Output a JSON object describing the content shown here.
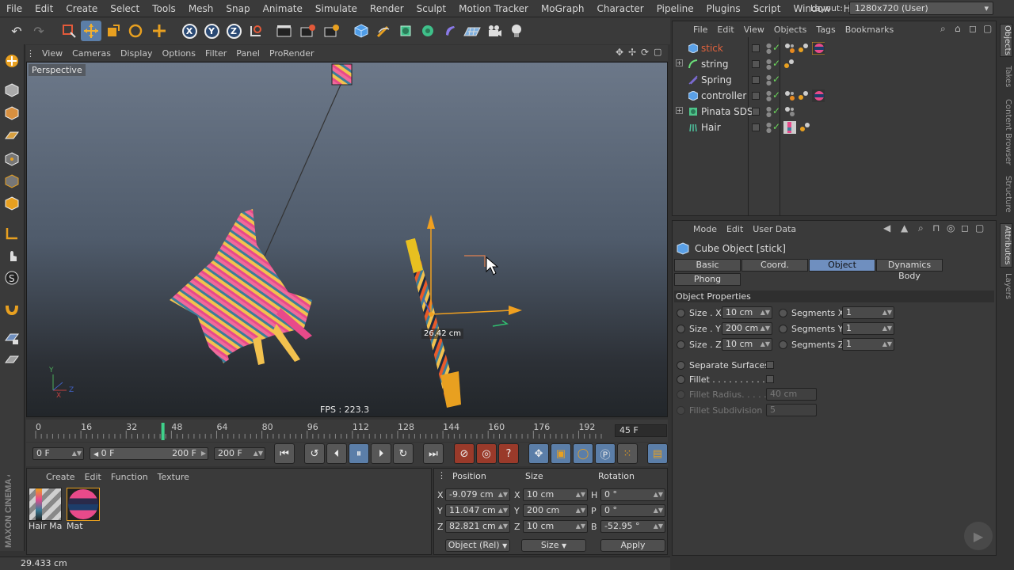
{
  "menubar": {
    "items": [
      "File",
      "Edit",
      "Create",
      "Select",
      "Tools",
      "Mesh",
      "Snap",
      "Animate",
      "Simulate",
      "Render",
      "Sculpt",
      "Motion Tracker",
      "MoGraph",
      "Character",
      "Pipeline",
      "Plugins",
      "Script",
      "Window",
      "Help"
    ],
    "layout_label": "Layout:",
    "layout_value": "1280x720 (User)"
  },
  "toolbar": {
    "icons": [
      "undo-icon",
      "redo-icon",
      "live-selection-icon",
      "move-icon",
      "scale-icon",
      "rotate-icon",
      "add-icon",
      "x-axis-icon",
      "y-axis-icon",
      "z-axis-icon",
      "coordinate-system-icon",
      "render-view-icon",
      "render-picture-queue-icon",
      "edit-render-settings-icon",
      "cube-icon",
      "pen-icon",
      "subdivision-icon",
      "array-icon",
      "deformer-icon",
      "floor-icon",
      "camera-icon",
      "light-icon"
    ],
    "axis_x": "X",
    "axis_y": "Y",
    "axis_z": "Z"
  },
  "viewport": {
    "menu": [
      "View",
      "Cameras",
      "Display",
      "Options",
      "Filter",
      "Panel",
      "ProRender"
    ],
    "camera_label": "Perspective",
    "fps": "FPS : 223.3",
    "dimension_label": "26.42 cm",
    "axis_y": "Y",
    "axis_x": "X",
    "axis_z": "Z"
  },
  "timeline": {
    "ticks": [
      "0",
      "16",
      "32",
      "48",
      "64",
      "80",
      "96",
      "112",
      "128",
      "144",
      "160",
      "176",
      "192"
    ],
    "current_frame_field": "45 F",
    "playhead_frame": 45,
    "max_frame": 200
  },
  "transport": {
    "start_field": "0 F",
    "range_start": "0 F",
    "range_end": "200 F",
    "end_field": "200 F"
  },
  "materials": {
    "menu": [
      "Create",
      "Edit",
      "Function",
      "Texture"
    ],
    "items": [
      {
        "label": "Hair Ma"
      },
      {
        "label": "Mat"
      }
    ]
  },
  "coordinates": {
    "headers": {
      "position": "Position",
      "size": "Size",
      "rotation": "Rotation"
    },
    "rows": [
      {
        "axis": "X",
        "pos": "-9.079 cm",
        "size_axis": "X",
        "size": "10 cm",
        "rot_axis": "H",
        "rot": "0 °"
      },
      {
        "axis": "Y",
        "pos": "11.047 cm",
        "size_axis": "Y",
        "size": "200 cm",
        "rot_axis": "P",
        "rot": "0 °"
      },
      {
        "axis": "Z",
        "pos": "82.821 cm",
        "size_axis": "Z",
        "size": "10 cm",
        "rot_axis": "B",
        "rot": "-52.95 °"
      }
    ],
    "mode_select": "Object (Rel)",
    "size_select": "Size",
    "apply_label": "Apply"
  },
  "statusbar": {
    "text": "29.433 cm"
  },
  "object_manager": {
    "menu": [
      "File",
      "Edit",
      "View",
      "Objects",
      "Tags",
      "Bookmarks"
    ],
    "objects": [
      {
        "name": "stick",
        "selected": true,
        "icon": "cube-object-icon",
        "color": "#5aa0e6"
      },
      {
        "name": "string",
        "selected": false,
        "icon": "spline-icon",
        "color": "#6be07a"
      },
      {
        "name": "Spring",
        "selected": false,
        "icon": "spring-icon",
        "color": "#7a6ad0"
      },
      {
        "name": "controller",
        "selected": false,
        "icon": "cube-object-icon",
        "color": "#5aa0e6"
      },
      {
        "name": "Pinata SDS",
        "selected": false,
        "icon": "subdivision-surface-icon",
        "color": "#4ec48a"
      },
      {
        "name": "Hair",
        "selected": false,
        "icon": "hair-icon",
        "color": "#4ec4a0"
      }
    ]
  },
  "attributes": {
    "menu": [
      "Mode",
      "Edit",
      "User Data"
    ],
    "title": "Cube Object [stick]",
    "tabs": [
      "Basic",
      "Coord.",
      "Object",
      "Dynamics Body",
      "Phong"
    ],
    "active_tab": "Object",
    "section": "Object Properties",
    "size_x_label": "Size . X",
    "size_x": "10 cm",
    "size_y_label": "Size . Y",
    "size_y": "200 cm",
    "size_z_label": "Size . Z",
    "size_z": "10 cm",
    "seg_x_label": "Segments X",
    "seg_x": "1",
    "seg_y_label": "Segments Y",
    "seg_y": "1",
    "seg_z_label": "Segments Z",
    "seg_z": "1",
    "separate_surfaces": "Separate Surfaces",
    "fillet": "Fillet . . . . . . . . . . .",
    "fillet_radius_label": "Fillet Radius. . . . .",
    "fillet_radius": "40 cm",
    "fillet_subdiv_label": "Fillet Subdivision",
    "fillet_subdiv": "5"
  },
  "side_tabs": [
    "Objects",
    "Takes",
    "Content Browser",
    "Structure",
    "Attributes",
    "Layers"
  ],
  "brand": "MAXON CINEMA 4D",
  "colors": {
    "accent": "#5b7ea8",
    "selected_object": "#e3623c",
    "active_tab": "#6f8fbf"
  }
}
